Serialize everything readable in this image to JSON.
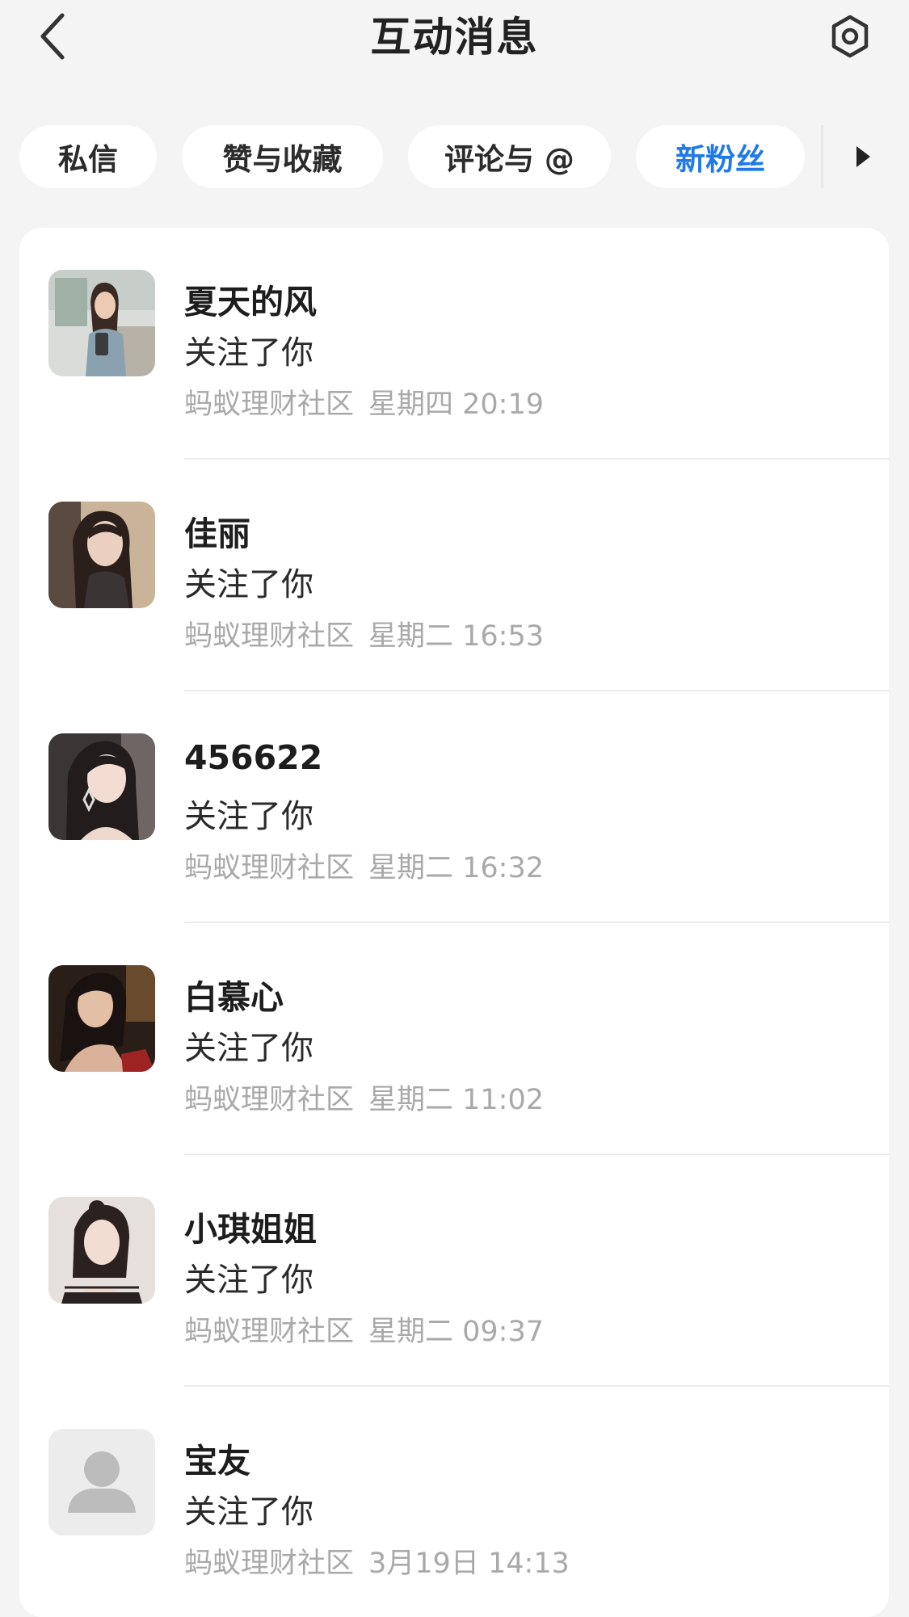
{
  "header": {
    "title": "互动消息",
    "back_icon": "chevron-left-icon",
    "settings_icon": "gear-icon"
  },
  "tabs": [
    {
      "label": "私信",
      "active": false
    },
    {
      "label": "赞与收藏",
      "active": false
    },
    {
      "label": "评论与 @",
      "active": false
    },
    {
      "label": "新粉丝",
      "active": true
    }
  ],
  "more_tabs_icon": "triangle-right-icon",
  "accent_color": "#1f7ae8",
  "followers": [
    {
      "name": "夏天的风",
      "action": "关注了你",
      "source": "蚂蚁理财社区",
      "time": "星期四 20:19"
    },
    {
      "name": "佳丽",
      "action": "关注了你",
      "source": "蚂蚁理财社区",
      "time": "星期二 16:53"
    },
    {
      "name": "456622",
      "action": "关注了你",
      "source": "蚂蚁理财社区",
      "time": "星期二 16:32"
    },
    {
      "name": "白慕心",
      "action": "关注了你",
      "source": "蚂蚁理财社区",
      "time": "星期二 11:02"
    },
    {
      "name": "小琪姐姐",
      "action": "关注了你",
      "source": "蚂蚁理财社区",
      "time": "星期二 09:37"
    },
    {
      "name": "宝友",
      "action": "关注了你",
      "source": "蚂蚁理财社区",
      "time": "3月19日 14:13"
    }
  ]
}
